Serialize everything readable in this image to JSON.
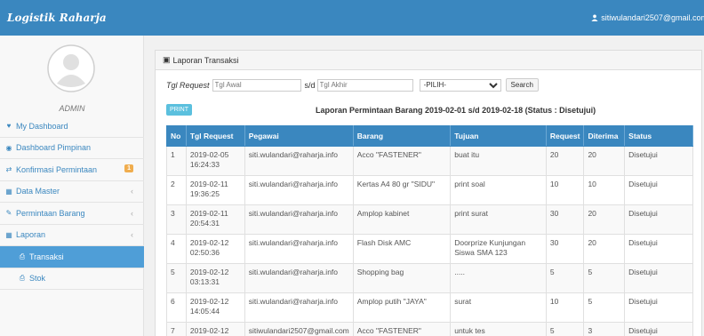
{
  "app": {
    "brand": "Logistik Raharja",
    "user_email": "sitiwulandari2507@gmail.com"
  },
  "colors": {
    "primary": "#3a87bf",
    "active": "#4f9ed7",
    "badge": "#f0ad4e",
    "print": "#5bc0de"
  },
  "sidebar": {
    "role": "ADMIN",
    "items": [
      {
        "label": "My Dashboard",
        "icon": "heart-icon"
      },
      {
        "label": "Dashboard Pimpinan",
        "icon": "gauge-icon"
      },
      {
        "label": "Konfirmasi Permintaan",
        "icon": "exchange-icon",
        "badge": "1"
      },
      {
        "label": "Data Master",
        "icon": "grid-icon"
      },
      {
        "label": "Permintaan Barang",
        "icon": "edit-icon"
      },
      {
        "label": "Laporan",
        "icon": "grid-icon"
      },
      {
        "label": "Transaksi",
        "icon": "printer-icon"
      },
      {
        "label": "Stok",
        "icon": "printer-icon"
      }
    ]
  },
  "panel": {
    "title": "Laporan Transaksi"
  },
  "filter": {
    "label": "Tgl Request",
    "start_placeholder": "Tgl Awal",
    "sep": "s/d",
    "end_placeholder": "Tgl Akhir",
    "select_value": "-PILIH-",
    "search_label": "Search"
  },
  "print_label": "PRINT",
  "report_title": "Laporan Permintaan Barang 2019-02-01 s/d 2019-02-18 (Status : Disetujui)",
  "table": {
    "headers": [
      "No",
      "Tgl Request",
      "Pegawai",
      "Barang",
      "Tujuan",
      "Request",
      "Diterima",
      "Status"
    ],
    "rows": [
      [
        "1",
        "2019-02-05 16:24:33",
        "siti.wulandari@raharja.info",
        "Acco \"FASTENER\"",
        "buat itu",
        "20",
        "20",
        "Disetujui"
      ],
      [
        "2",
        "2019-02-11 19:36:25",
        "siti.wulandari@raharja.info",
        "Kertas A4 80 gr \"SIDU\"",
        "print soal",
        "10",
        "10",
        "Disetujui"
      ],
      [
        "3",
        "2019-02-11 20:54:31",
        "siti.wulandari@raharja.info",
        "Amplop kabinet",
        "print surat",
        "30",
        "20",
        "Disetujui"
      ],
      [
        "4",
        "2019-02-12 02:50:36",
        "siti.wulandari@raharja.info",
        "Flash Disk AMC",
        "Doorprize Kunjungan Siswa SMA 123",
        "30",
        "20",
        "Disetujui"
      ],
      [
        "5",
        "2019-02-12 03:13:31",
        "siti.wulandari@raharja.info",
        "Shopping bag",
        ".....",
        "5",
        "5",
        "Disetujui"
      ],
      [
        "6",
        "2019-02-12 14:05:44",
        "siti.wulandari@raharja.info",
        "Amplop putih \"JAYA\"",
        "surat",
        "10",
        "5",
        "Disetujui"
      ],
      [
        "7",
        "2019-02-12",
        "sitiwulandari2507@gmail.com",
        "Acco \"FASTENER\"",
        "untuk tes",
        "5",
        "3",
        "Disetujui"
      ]
    ]
  }
}
